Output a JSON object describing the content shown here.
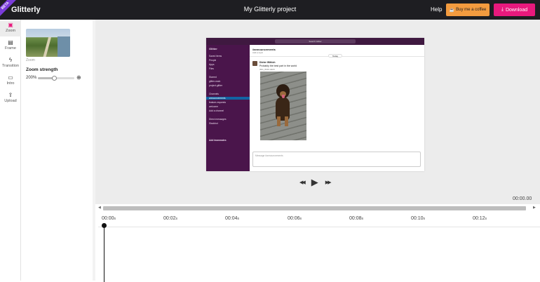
{
  "header": {
    "badge": "BETA",
    "logo": "Glitterly",
    "project_title": "My Glitterly project",
    "help_label": "Help",
    "coffee_label": "Buy me a coffee",
    "download_label": "Download"
  },
  "rail": {
    "items": [
      {
        "label": "Zoom",
        "icon": "zoom-icon",
        "active": true
      },
      {
        "label": "Frame",
        "icon": "frame-icon",
        "active": false
      },
      {
        "label": "Transition",
        "icon": "transition-icon",
        "active": false
      },
      {
        "label": "Intro",
        "icon": "camera-icon",
        "active": false
      },
      {
        "label": "Upload",
        "icon": "upload-icon",
        "active": false
      }
    ]
  },
  "panel": {
    "thumb_caption": "Zoom",
    "zoom_strength_label": "Zoom strength",
    "zoom_value": "200%",
    "zoom_fraction": 0.45
  },
  "preview": {
    "search_placeholder": "Search Glitter",
    "workspace": "Glitter",
    "sidebar_items": [
      "Saved items",
      "People",
      "Apps",
      "Files",
      "Starred",
      "glitter-main",
      "project-glitter",
      "Channels",
      "announcements",
      "feature-requests",
      "welcome",
      "Add a channel",
      "Direct messages",
      "Slackbot",
      "Add teammates"
    ],
    "channel_title": "#announcements",
    "channel_sub": "Add a topic",
    "date_pill": "Today",
    "author": "Dieter Wittich",
    "message": "Probably the best part in the world",
    "file_name": "IMG_8229.HEIC",
    "compose_placeholder": "Message #announcements"
  },
  "player": {
    "prev_label": "◀◀",
    "play_label": "▶",
    "next_label": "▶▶",
    "duration": "00:00.00"
  },
  "timeline": {
    "ticks": [
      {
        "t": "00:00",
        "u": "s"
      },
      {
        "t": "00:02",
        "u": "s"
      },
      {
        "t": "00:04",
        "u": "s"
      },
      {
        "t": "00:06",
        "u": "s"
      },
      {
        "t": "00:08",
        "u": "s"
      },
      {
        "t": "00:10",
        "u": "s"
      },
      {
        "t": "00:12",
        "u": "s"
      }
    ]
  }
}
